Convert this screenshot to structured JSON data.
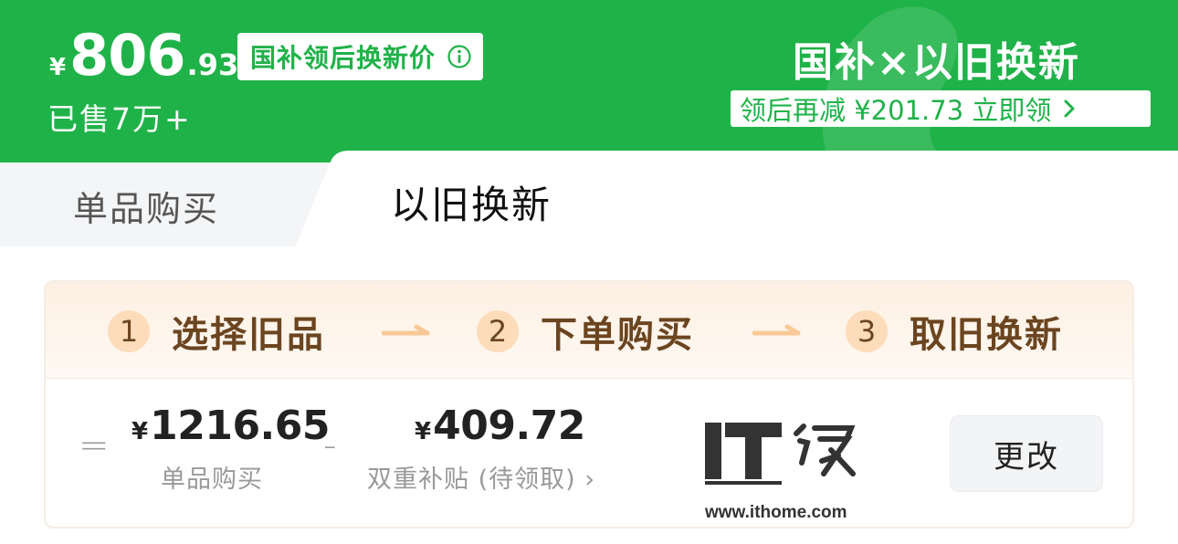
{
  "header": {
    "price": {
      "currency": "¥",
      "integer": "806",
      "decimal": ".93"
    },
    "price_badge": "国补领后换新价",
    "sold": "已售7万+",
    "promo_title": "国补×以旧换新",
    "promo_detail": "领后再减 ¥201.73 立即领",
    "colors": {
      "brand_green": "#1fb248"
    }
  },
  "tabs": [
    {
      "label": "单品购买",
      "active": false
    },
    {
      "label": "以旧换新",
      "active": true
    }
  ],
  "steps": [
    {
      "num": "1",
      "label": "选择旧品"
    },
    {
      "num": "2",
      "label": "下单购买"
    },
    {
      "num": "3",
      "label": "取旧换新"
    }
  ],
  "calc": {
    "equals": "=",
    "minus": "-",
    "single_price": {
      "currency": "¥",
      "value": "1216.65",
      "label": "单品购买"
    },
    "subsidy": {
      "currency": "¥",
      "value": "409.72",
      "label": "双重补贴 (待领取) ›"
    },
    "change_label": "更改"
  },
  "watermark": {
    "brand": "IT之家",
    "url": "www.ithome.com"
  },
  "icons": [
    "info-icon",
    "chevron-right-icon",
    "arrow-right-icon"
  ]
}
